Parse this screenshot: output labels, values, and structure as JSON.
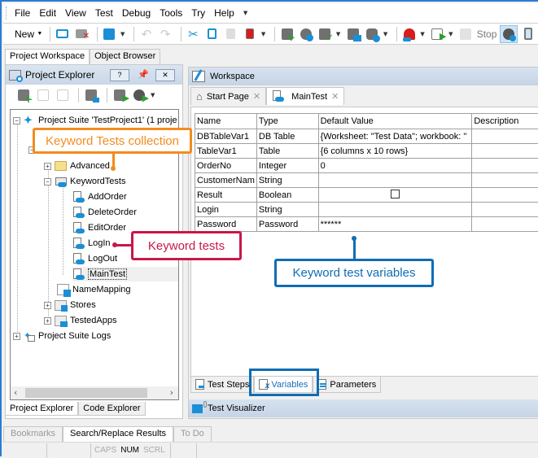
{
  "menu": [
    "File",
    "Edit",
    "View",
    "Test",
    "Debug",
    "Tools",
    "Try",
    "Help"
  ],
  "toolbar": {
    "new_label": "New",
    "stop_label": "Stop",
    "icons": [
      "open-folder-icon",
      "close-project-icon",
      "save-icon",
      "undo-icon",
      "redo-icon",
      "cut-icon",
      "copy-icon",
      "paste-icon",
      "delete-icon",
      "add-item-icon",
      "object-spy-icon",
      "checkpoint-icon",
      "virtual-desktop-icon",
      "database-settings-icon",
      "record-icon",
      "run-icon",
      "stop-icon",
      "debug-icon",
      "mobile-icon"
    ]
  },
  "pane_tabs": [
    "Project Workspace",
    "Object Browser"
  ],
  "project_explorer": {
    "title": "Project Explorer",
    "help_label": "?",
    "close_label": "✕",
    "tree": [
      {
        "label": "Project Suite 'TestProject1' (1 proje",
        "level": 0,
        "expander": "-"
      },
      {
        "label": "Advanced",
        "level": 2,
        "expander": "+",
        "icon": "folder"
      },
      {
        "label": "KeywordTests",
        "level": 2,
        "expander": "-",
        "icon": "keyword-folder"
      },
      {
        "label": "AddOrder",
        "level": 3,
        "icon": "keyword-test"
      },
      {
        "label": "DeleteOrder",
        "level": 3,
        "icon": "keyword-test"
      },
      {
        "label": "EditOrder",
        "level": 3,
        "icon": "keyword-test"
      },
      {
        "label": "LogIn",
        "level": 3,
        "icon": "keyword-test"
      },
      {
        "label": "LogOut",
        "level": 3,
        "icon": "keyword-test"
      },
      {
        "label": "MainTest",
        "level": 3,
        "icon": "keyword-test",
        "selected": true
      },
      {
        "label": "NameMapping",
        "level": 2,
        "icon": "name-mapping"
      },
      {
        "label": "Stores",
        "level": 2,
        "expander": "+",
        "icon": "stores"
      },
      {
        "label": "TestedApps",
        "level": 2,
        "expander": "+",
        "icon": "tested-apps"
      },
      {
        "label": "Project Suite Logs",
        "level": 0,
        "expander": "+",
        "icon": "logs"
      }
    ]
  },
  "left_bottom_tabs": [
    "Project Explorer",
    "Code Explorer"
  ],
  "workspace": {
    "title": "Workspace",
    "doc_tabs": [
      {
        "label": "Start Page",
        "active": false
      },
      {
        "label": "MainTest",
        "active": true
      }
    ],
    "table": {
      "headers": [
        "Name",
        "Type",
        "Default Value",
        "Description"
      ],
      "rows": [
        [
          "DBTableVar1",
          "DB Table",
          "{Worksheet: \"Test Data\"; workbook: \"",
          ""
        ],
        [
          "TableVar1",
          "Table",
          "{6 columns x 10 rows}",
          ""
        ],
        [
          "OrderNo",
          "Integer",
          "0",
          ""
        ],
        [
          "CustomerNam",
          "String",
          "",
          ""
        ],
        [
          "Result",
          "Boolean",
          "[checkbox-unchecked]",
          ""
        ],
        [
          "Login",
          "String",
          "",
          ""
        ],
        [
          "Password",
          "Password",
          "******",
          ""
        ]
      ]
    },
    "editor_tabs": [
      {
        "label": "Test Steps",
        "active": false
      },
      {
        "label": "Variables",
        "active": true
      },
      {
        "label": "Parameters",
        "active": false
      }
    ],
    "visualizer_title": "Test Visualizer"
  },
  "output_tabs": [
    {
      "label": "Bookmarks",
      "active": false
    },
    {
      "label": "Search/Replace Results",
      "active": true
    },
    {
      "label": "To Do",
      "active": false
    }
  ],
  "status": {
    "caps": "CAPS",
    "num": "NUM",
    "scrl": "SCRL"
  },
  "callouts": {
    "collection": "Keyword Tests collection",
    "tests": "Keyword tests",
    "variables": "Keyword test variables"
  },
  "colors": {
    "orange": "#f28c1e",
    "red": "#c8174a",
    "blue": "#0f6db4"
  }
}
